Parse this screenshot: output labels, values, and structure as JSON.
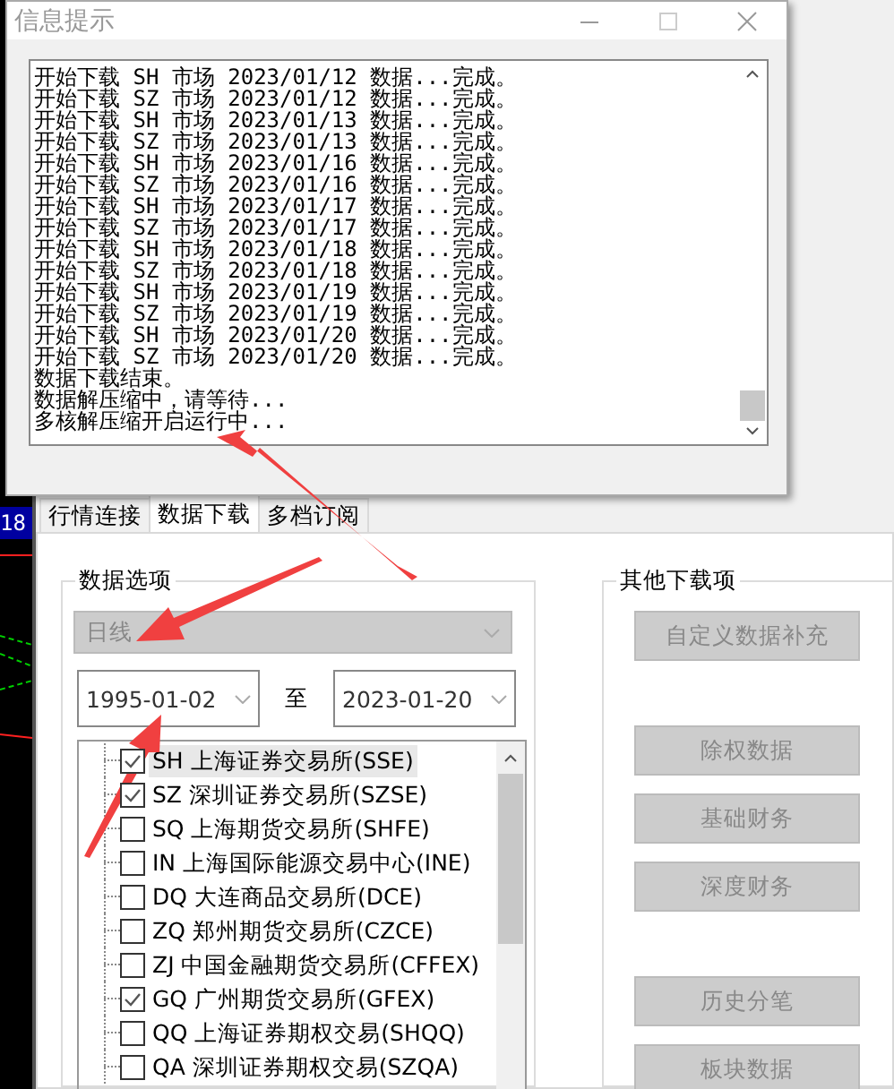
{
  "chart": {
    "price_tag": "18"
  },
  "popup": {
    "title": "信息提示",
    "log_lines": [
      "开始下载 SH 市场 2023/01/12 数据...完成。",
      "开始下载 SZ 市场 2023/01/12 数据...完成。",
      "开始下载 SH 市场 2023/01/13 数据...完成。",
      "开始下载 SZ 市场 2023/01/13 数据...完成。",
      "开始下载 SH 市场 2023/01/16 数据...完成。",
      "开始下载 SZ 市场 2023/01/16 数据...完成。",
      "开始下载 SH 市场 2023/01/17 数据...完成。",
      "开始下载 SZ 市场 2023/01/17 数据...完成。",
      "开始下载 SH 市场 2023/01/18 数据...完成。",
      "开始下载 SZ 市场 2023/01/18 数据...完成。",
      "开始下载 SH 市场 2023/01/19 数据...完成。",
      "开始下载 SZ 市场 2023/01/19 数据...完成。",
      "开始下载 SH 市场 2023/01/20 数据...完成。",
      "开始下载 SZ 市场 2023/01/20 数据...完成。",
      "数据下载结束。",
      "数据解压缩中，请等待...",
      "多核解压缩开启运行中..."
    ]
  },
  "tabs": [
    {
      "label": "行情连接",
      "selected": false
    },
    {
      "label": "数据下载",
      "selected": true
    },
    {
      "label": "多档订阅",
      "selected": false
    }
  ],
  "data_options": {
    "title": "数据选项",
    "period": {
      "value": "日线",
      "disabled": true
    },
    "date_from": "1995-01-02",
    "to_label": "至",
    "date_to": "2023-01-20",
    "markets": [
      {
        "label": "SH 上海证券交易所(SSE)",
        "checked": true,
        "selected": true
      },
      {
        "label": "SZ 深圳证券交易所(SZSE)",
        "checked": true,
        "selected": false
      },
      {
        "label": "SQ 上海期货交易所(SHFE)",
        "checked": false,
        "selected": false
      },
      {
        "label": "IN 上海国际能源交易中心(INE)",
        "checked": false,
        "selected": false
      },
      {
        "label": "DQ 大连商品交易所(DCE)",
        "checked": false,
        "selected": false
      },
      {
        "label": "ZQ 郑州期货交易所(CZCE)",
        "checked": false,
        "selected": false
      },
      {
        "label": "ZJ 中国金融期货交易所(CFFEX)",
        "checked": false,
        "selected": false
      },
      {
        "label": "GQ 广州期货交易所(GFEX)",
        "checked": true,
        "selected": false
      },
      {
        "label": "QQ 上海证券期权交易(SHQQ)",
        "checked": false,
        "selected": false
      },
      {
        "label": "QA 深圳证券期权交易(SZQA)",
        "checked": false,
        "selected": false
      }
    ]
  },
  "other_downloads": {
    "title": "其他下载项",
    "button_groups": [
      [
        {
          "label": "自定义数据补充",
          "disabled": true
        }
      ],
      [
        {
          "label": "除权数据",
          "disabled": true
        },
        {
          "label": "基础财务",
          "disabled": true
        },
        {
          "label": "深度财务",
          "disabled": true
        }
      ],
      [
        {
          "label": "历史分笔",
          "disabled": true
        },
        {
          "label": "板块数据",
          "disabled": true
        }
      ]
    ]
  }
}
